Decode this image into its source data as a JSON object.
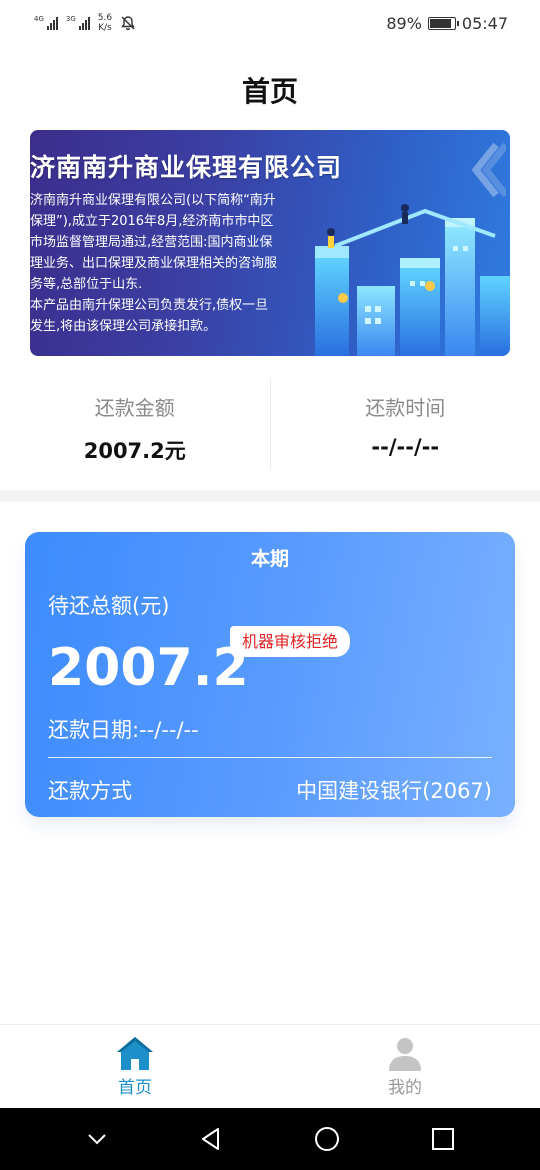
{
  "status_bar": {
    "signal1_tag": "4G",
    "signal2_tag": "3G",
    "net_speed_value": "5.6",
    "net_speed_unit": "K/s",
    "battery_percent": "89%",
    "battery_level": 0.89,
    "time": "05:47",
    "icons": [
      "signal-icon",
      "signal-icon",
      "mute-bell-icon",
      "battery-icon"
    ]
  },
  "header": {
    "title": "首页"
  },
  "banner": {
    "company": "济南南升商业保理有限公司",
    "lines": [
      "济南南升商业保理有限公司(以下简称“南升",
      "保理”),成立于2016年8月,经济南市市中区",
      "市场监督管理局通过,经营范围:国内商业保",
      "理业务、出口保理及商业保理相关的咨询服",
      "务等,总部位于山东.",
      "本产品由南升保理公司负责发行,债权一旦",
      "发生,将由该保理公司承接扣款。"
    ]
  },
  "summary": {
    "amount_label": "还款金额",
    "amount_value": "2007.2元",
    "time_label": "还款时间",
    "time_value": "--/--/--"
  },
  "card": {
    "title": "本期",
    "total_label": "待还总额(元)",
    "amount": "2007.2",
    "status_badge": "机器审核拒绝",
    "due_date": "还款日期:--/--/--",
    "method_label": "还款方式",
    "method_value": "中国建设银行(2067)"
  },
  "bottom_nav": {
    "items": [
      {
        "label": "首页",
        "icon": "home-icon",
        "active": true
      },
      {
        "label": "我的",
        "icon": "user-icon",
        "active": false
      }
    ],
    "active_color": "#1d8fc9"
  },
  "system_nav": {
    "icons": [
      "chevron-down-icon",
      "back-icon",
      "home-circle-icon",
      "recents-icon"
    ]
  }
}
